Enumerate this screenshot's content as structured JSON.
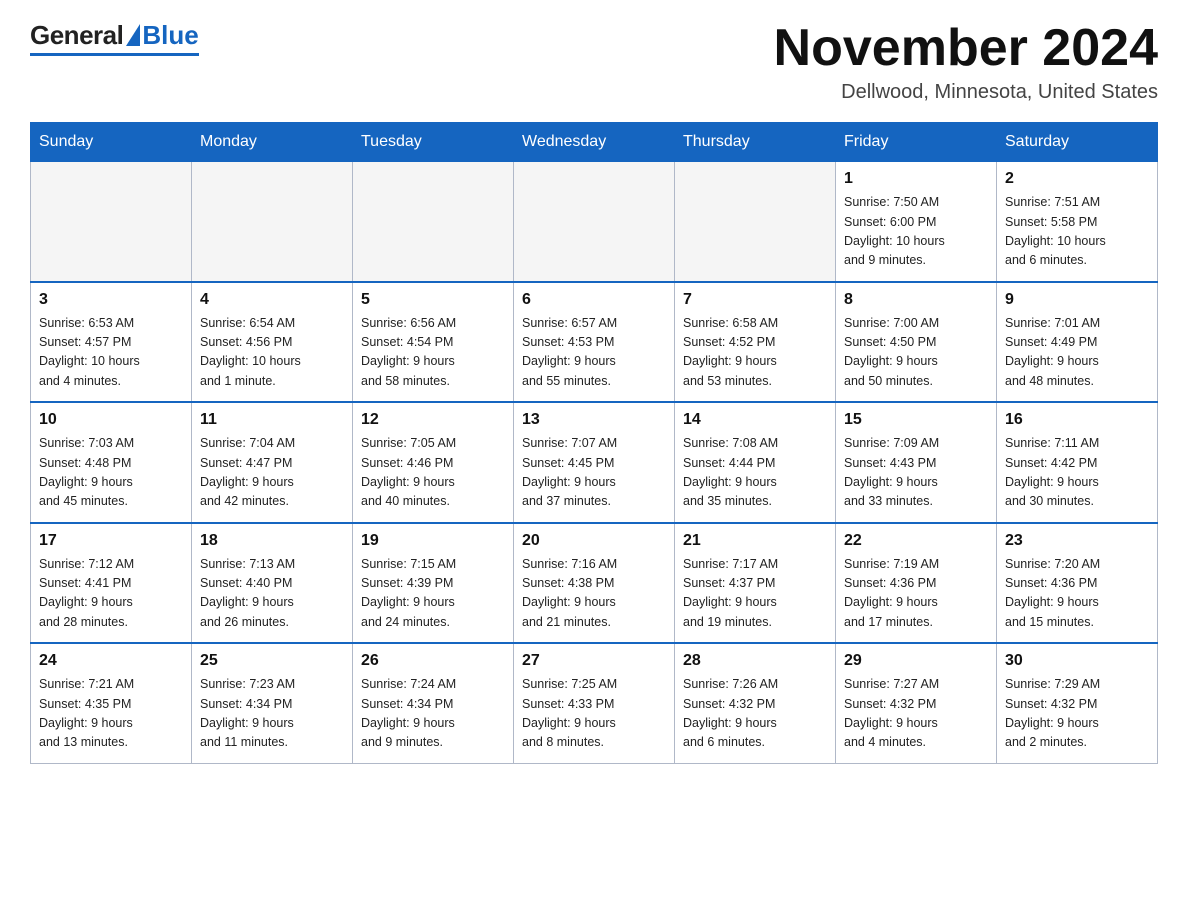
{
  "logo": {
    "general": "General",
    "blue": "Blue"
  },
  "header": {
    "month_title": "November 2024",
    "location": "Dellwood, Minnesota, United States"
  },
  "weekdays": [
    "Sunday",
    "Monday",
    "Tuesday",
    "Wednesday",
    "Thursday",
    "Friday",
    "Saturday"
  ],
  "weeks": [
    [
      {
        "day": "",
        "info": ""
      },
      {
        "day": "",
        "info": ""
      },
      {
        "day": "",
        "info": ""
      },
      {
        "day": "",
        "info": ""
      },
      {
        "day": "",
        "info": ""
      },
      {
        "day": "1",
        "info": "Sunrise: 7:50 AM\nSunset: 6:00 PM\nDaylight: 10 hours\nand 9 minutes."
      },
      {
        "day": "2",
        "info": "Sunrise: 7:51 AM\nSunset: 5:58 PM\nDaylight: 10 hours\nand 6 minutes."
      }
    ],
    [
      {
        "day": "3",
        "info": "Sunrise: 6:53 AM\nSunset: 4:57 PM\nDaylight: 10 hours\nand 4 minutes."
      },
      {
        "day": "4",
        "info": "Sunrise: 6:54 AM\nSunset: 4:56 PM\nDaylight: 10 hours\nand 1 minute."
      },
      {
        "day": "5",
        "info": "Sunrise: 6:56 AM\nSunset: 4:54 PM\nDaylight: 9 hours\nand 58 minutes."
      },
      {
        "day": "6",
        "info": "Sunrise: 6:57 AM\nSunset: 4:53 PM\nDaylight: 9 hours\nand 55 minutes."
      },
      {
        "day": "7",
        "info": "Sunrise: 6:58 AM\nSunset: 4:52 PM\nDaylight: 9 hours\nand 53 minutes."
      },
      {
        "day": "8",
        "info": "Sunrise: 7:00 AM\nSunset: 4:50 PM\nDaylight: 9 hours\nand 50 minutes."
      },
      {
        "day": "9",
        "info": "Sunrise: 7:01 AM\nSunset: 4:49 PM\nDaylight: 9 hours\nand 48 minutes."
      }
    ],
    [
      {
        "day": "10",
        "info": "Sunrise: 7:03 AM\nSunset: 4:48 PM\nDaylight: 9 hours\nand 45 minutes."
      },
      {
        "day": "11",
        "info": "Sunrise: 7:04 AM\nSunset: 4:47 PM\nDaylight: 9 hours\nand 42 minutes."
      },
      {
        "day": "12",
        "info": "Sunrise: 7:05 AM\nSunset: 4:46 PM\nDaylight: 9 hours\nand 40 minutes."
      },
      {
        "day": "13",
        "info": "Sunrise: 7:07 AM\nSunset: 4:45 PM\nDaylight: 9 hours\nand 37 minutes."
      },
      {
        "day": "14",
        "info": "Sunrise: 7:08 AM\nSunset: 4:44 PM\nDaylight: 9 hours\nand 35 minutes."
      },
      {
        "day": "15",
        "info": "Sunrise: 7:09 AM\nSunset: 4:43 PM\nDaylight: 9 hours\nand 33 minutes."
      },
      {
        "day": "16",
        "info": "Sunrise: 7:11 AM\nSunset: 4:42 PM\nDaylight: 9 hours\nand 30 minutes."
      }
    ],
    [
      {
        "day": "17",
        "info": "Sunrise: 7:12 AM\nSunset: 4:41 PM\nDaylight: 9 hours\nand 28 minutes."
      },
      {
        "day": "18",
        "info": "Sunrise: 7:13 AM\nSunset: 4:40 PM\nDaylight: 9 hours\nand 26 minutes."
      },
      {
        "day": "19",
        "info": "Sunrise: 7:15 AM\nSunset: 4:39 PM\nDaylight: 9 hours\nand 24 minutes."
      },
      {
        "day": "20",
        "info": "Sunrise: 7:16 AM\nSunset: 4:38 PM\nDaylight: 9 hours\nand 21 minutes."
      },
      {
        "day": "21",
        "info": "Sunrise: 7:17 AM\nSunset: 4:37 PM\nDaylight: 9 hours\nand 19 minutes."
      },
      {
        "day": "22",
        "info": "Sunrise: 7:19 AM\nSunset: 4:36 PM\nDaylight: 9 hours\nand 17 minutes."
      },
      {
        "day": "23",
        "info": "Sunrise: 7:20 AM\nSunset: 4:36 PM\nDaylight: 9 hours\nand 15 minutes."
      }
    ],
    [
      {
        "day": "24",
        "info": "Sunrise: 7:21 AM\nSunset: 4:35 PM\nDaylight: 9 hours\nand 13 minutes."
      },
      {
        "day": "25",
        "info": "Sunrise: 7:23 AM\nSunset: 4:34 PM\nDaylight: 9 hours\nand 11 minutes."
      },
      {
        "day": "26",
        "info": "Sunrise: 7:24 AM\nSunset: 4:34 PM\nDaylight: 9 hours\nand 9 minutes."
      },
      {
        "day": "27",
        "info": "Sunrise: 7:25 AM\nSunset: 4:33 PM\nDaylight: 9 hours\nand 8 minutes."
      },
      {
        "day": "28",
        "info": "Sunrise: 7:26 AM\nSunset: 4:32 PM\nDaylight: 9 hours\nand 6 minutes."
      },
      {
        "day": "29",
        "info": "Sunrise: 7:27 AM\nSunset: 4:32 PM\nDaylight: 9 hours\nand 4 minutes."
      },
      {
        "day": "30",
        "info": "Sunrise: 7:29 AM\nSunset: 4:32 PM\nDaylight: 9 hours\nand 2 minutes."
      }
    ]
  ]
}
